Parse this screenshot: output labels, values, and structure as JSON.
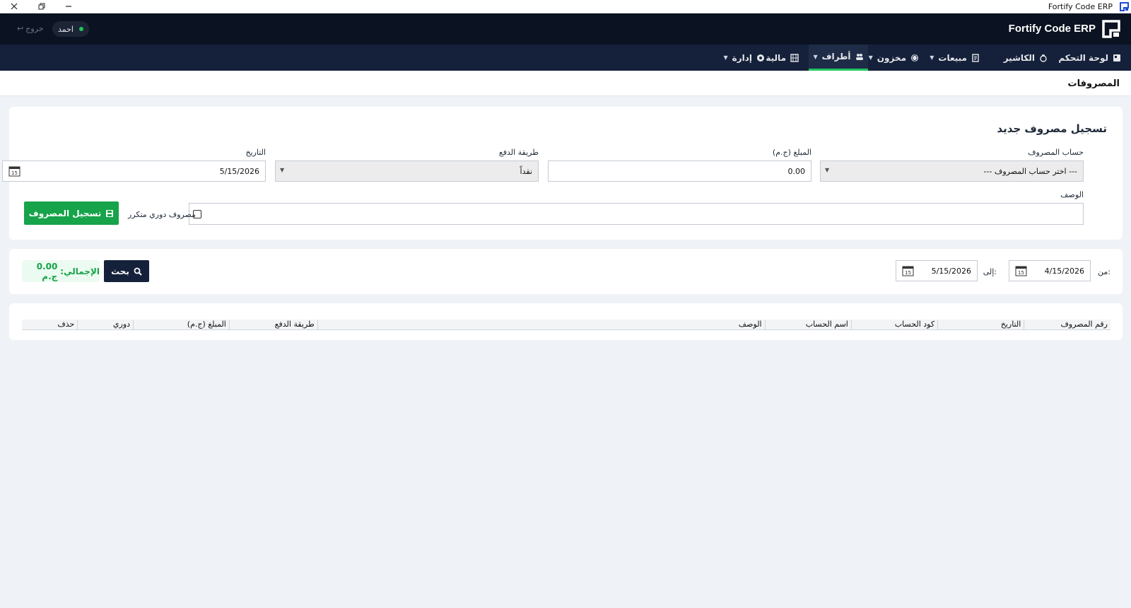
{
  "window": {
    "title": "Fortify Code ERP"
  },
  "header": {
    "brand": "Fortify Code ERP",
    "user_name": "احمد",
    "logout_label": "خروج"
  },
  "nav": {
    "items": [
      {
        "label": "لوحة التحكم",
        "icon": "dashboard-icon",
        "has_dropdown": false
      },
      {
        "label": "الكاشير",
        "icon": "cashier-icon",
        "has_dropdown": false
      },
      {
        "label": "مبيعات",
        "icon": "receipt-icon",
        "has_dropdown": true
      },
      {
        "label": "مخزون",
        "icon": "box-icon",
        "has_dropdown": true
      },
      {
        "label": "أطراف",
        "icon": "users-icon",
        "has_dropdown": true,
        "active": true
      },
      {
        "label": "مالية",
        "icon": "calculator-icon",
        "has_dropdown": true
      },
      {
        "label": "إدارة",
        "icon": "gear-icon",
        "has_dropdown": true
      }
    ]
  },
  "page": {
    "title": "المصروفات"
  },
  "form": {
    "title": "تسجيل مصروف جديد",
    "account_label": "حساب المصروف",
    "account_value": "--- اختر حساب المصروف ---",
    "amount_label": "المبلغ (ج.م)",
    "amount_value": "0.00",
    "payment_label": "طريقة الدفع",
    "payment_value": "نقداً",
    "date_label": "التاريخ",
    "date_value": "5/15/2026",
    "description_label": "الوصف",
    "description_value": "",
    "recurring_label": "مصروف دوري متكرر",
    "recurring_checked": false,
    "save_label": "تسجيل المصروف"
  },
  "filter": {
    "from_label": "من:",
    "from_value": "4/15/2026",
    "to_label": "إلى:",
    "to_value": "5/15/2026",
    "search_label": "بحث",
    "total_label": "الإجمالي:",
    "total_value": "0.00 ج.م"
  },
  "table": {
    "columns": [
      "رقم المصروف",
      "التاريخ",
      "كود الحساب",
      "اسم الحساب",
      "الوصف",
      "طريقة الدفع",
      "المبلغ (ج.م)",
      "دوري",
      "حذف"
    ],
    "rows": []
  },
  "colors": {
    "accent": "#16a34a",
    "navy": "#15213a",
    "header": "#0b1322"
  }
}
